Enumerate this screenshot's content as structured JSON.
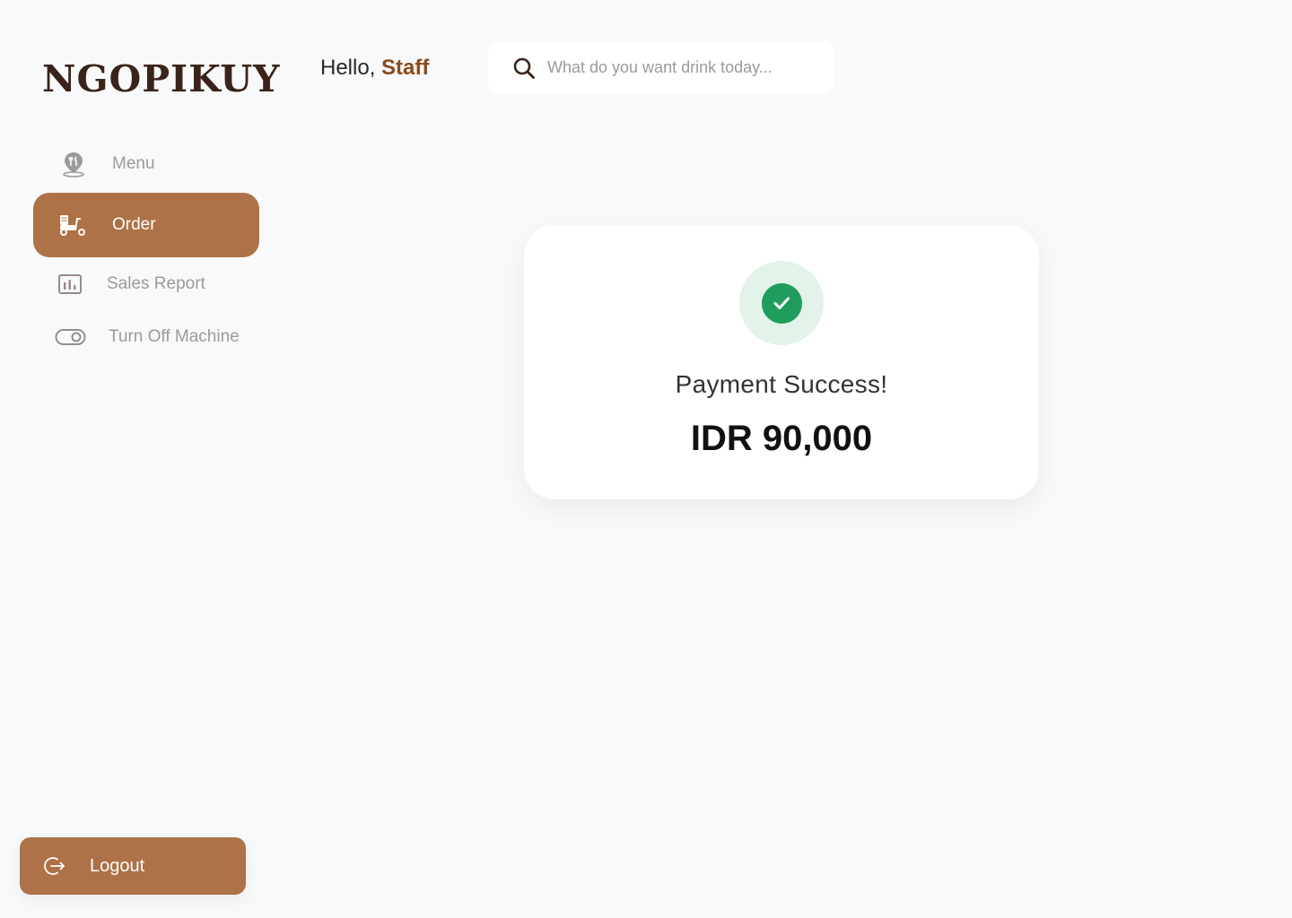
{
  "brand": {
    "logo_text": "NGOPIKUY"
  },
  "header": {
    "greeting_prefix": "Hello, ",
    "user_name": "Staff"
  },
  "search": {
    "placeholder": "What do you want drink today...",
    "value": "",
    "icon": "search-icon"
  },
  "sidebar": {
    "items": [
      {
        "label": "Menu",
        "icon": "restaurant-pin-icon",
        "active": false
      },
      {
        "label": "Order",
        "icon": "delivery-scooter-icon",
        "active": true
      },
      {
        "label": "Sales Report",
        "icon": "bar-chart-icon",
        "active": false
      },
      {
        "label": "Turn Off Machine",
        "icon": "toggle-icon",
        "active": false
      }
    ],
    "logout_label": "Logout",
    "logout_icon": "logout-icon"
  },
  "payment": {
    "status_text": "Payment Success!",
    "amount": "IDR 90,000",
    "status_icon": "check-circle-icon"
  },
  "colors": {
    "accent": "#ad7247",
    "brand_dark": "#3a2419",
    "name_highlight": "#8a4a1c",
    "success": "#1f9d5c",
    "success_bg": "#e3f3ea",
    "background": "#f8f9fb"
  }
}
